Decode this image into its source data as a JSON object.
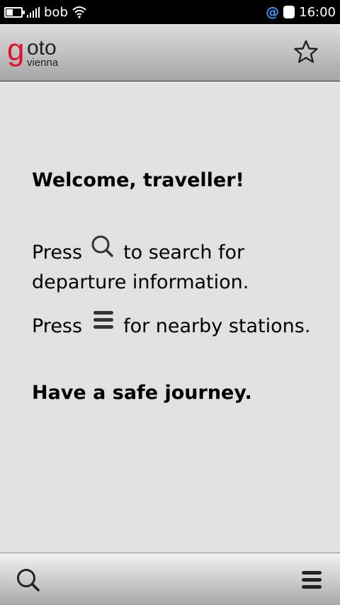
{
  "status_bar": {
    "carrier": "bob",
    "time": "16:00",
    "at_symbol": "@"
  },
  "header": {
    "logo_g": "g",
    "logo_oto": "oto",
    "logo_sub": "vienna",
    "star_icon": "star-icon"
  },
  "welcome": {
    "title": "Welcome, traveller!",
    "line1_prefix": "Press",
    "line1_suffix": "to search for",
    "line1_cont": "departure information.",
    "line2_prefix": "Press",
    "line2_suffix": "for nearby stations.",
    "closing": "Have a safe journey."
  },
  "toolbar": {
    "search_icon": "search-icon",
    "menu_icon": "menu-icon"
  },
  "colors": {
    "brand_red": "#e0112b",
    "background": "#e1e1e3",
    "status_accent": "#3aa0ff"
  }
}
